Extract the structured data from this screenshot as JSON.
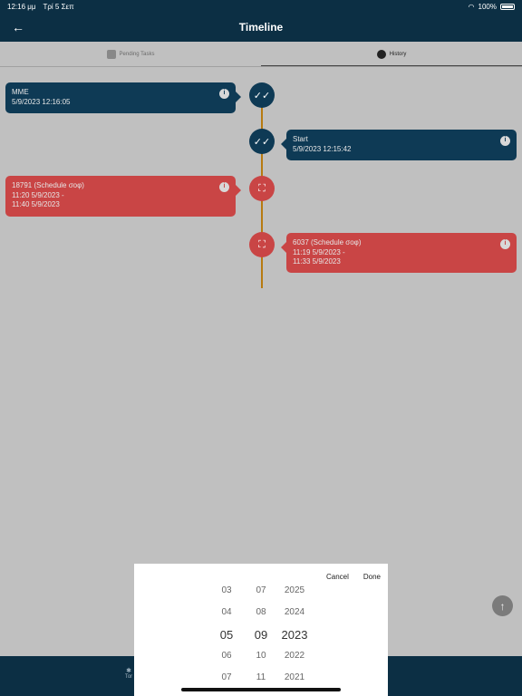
{
  "status_bar": {
    "time": "12:16 μμ",
    "date": "Τρί 5 Σεπ",
    "battery": "100%"
  },
  "app_bar": {
    "title": "Timeline",
    "back_icon": "arrow-left-icon"
  },
  "tabs": [
    {
      "label": "Pending Tasks",
      "icon": "tasks-icon",
      "active": false
    },
    {
      "label": "History",
      "icon": "clock-icon",
      "active": true
    }
  ],
  "timeline": [
    {
      "side": "left",
      "type": "blue",
      "icon": "double-check-icon",
      "lines": [
        "MME",
        "5/9/2023 12:16:05"
      ]
    },
    {
      "side": "right",
      "type": "blue",
      "icon": "double-check-icon",
      "lines": [
        "Start",
        "5/9/2023 12:15:42"
      ]
    },
    {
      "side": "left",
      "type": "red",
      "icon": "fullscreen-icon",
      "lines": [
        "18791 (Schedule σοφ)",
        "11:20 5/9/2023 -",
        "11:40 5/9/2023"
      ]
    },
    {
      "side": "right",
      "type": "red",
      "icon": "fullscreen-icon",
      "lines": [
        "6037 (Schedule σοφ)",
        "11:19 5/9/2023 -",
        "11:33 5/9/2023"
      ]
    }
  ],
  "colors": {
    "primary": "#0e3a55",
    "danger": "#c94545",
    "line": "#b77a10"
  },
  "bottom_nav": {
    "label": "Tor"
  },
  "picker": {
    "cancel_label": "Cancel",
    "done_label": "Done",
    "days": [
      "03",
      "04",
      "05",
      "06",
      "07"
    ],
    "months": [
      "07",
      "08",
      "09",
      "10",
      "11"
    ],
    "years": [
      "2025",
      "2024",
      "2023",
      "2022",
      "2021"
    ],
    "selected_index": 2
  }
}
